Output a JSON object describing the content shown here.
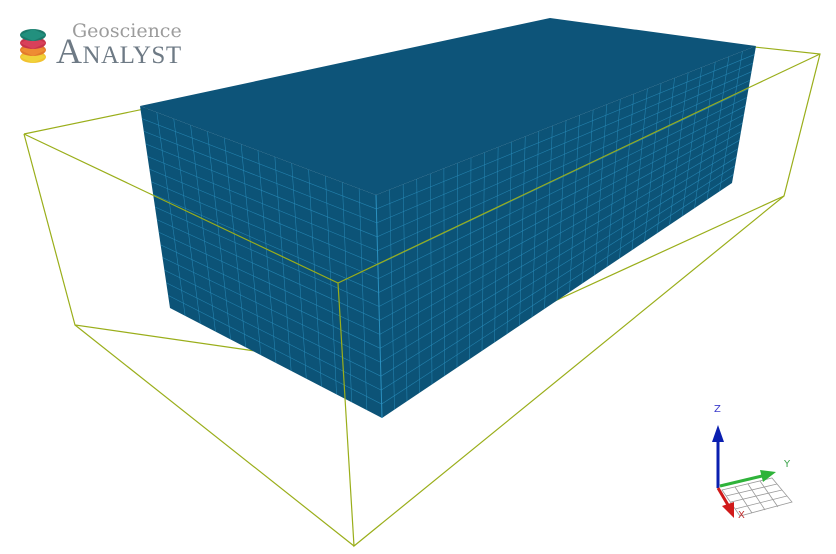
{
  "logo": {
    "line1": "Geoscience",
    "line2": "Analyst",
    "icon": "layered-stack-logo"
  },
  "scene": {
    "block_color": "#0c5377",
    "block_top_color": "#0d5479",
    "grid_line_color": "#2b90bf",
    "bounding_box_color": "#9aae1a",
    "background": "#ffffff"
  },
  "axes": {
    "z_label": "Z",
    "y_label": "Y",
    "x_label": "X",
    "z_color": "#0a1fb0",
    "y_color": "#2fb33a",
    "x_color": "#d01a1a"
  }
}
